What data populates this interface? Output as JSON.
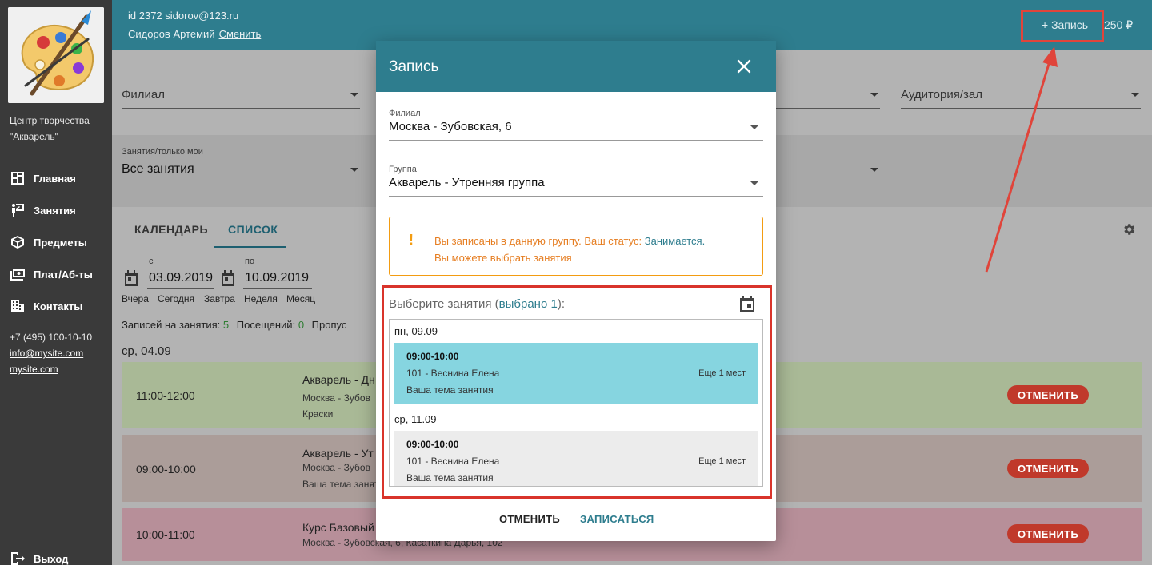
{
  "sidebar": {
    "org_name": "Центр творчества \"Акварель\"",
    "items": [
      {
        "label": "Главная",
        "icon": "dashboard-icon"
      },
      {
        "label": "Занятия",
        "icon": "lessons-icon"
      },
      {
        "label": "Предметы",
        "icon": "box-icon"
      },
      {
        "label": "Плат/Аб-ты",
        "icon": "money-icon"
      },
      {
        "label": "Контакты",
        "icon": "building-icon"
      }
    ],
    "phone": "+7 (495) 100-10-10",
    "email": "info@mysite.com",
    "site": "mysite.com",
    "logout": "Выход"
  },
  "header": {
    "user_id": "id 2372 sidorov@123.ru",
    "user_name": "Сидоров Артемий",
    "change_label": "Сменить",
    "record_label": "+ Запись",
    "balance": "250 ₽"
  },
  "filters": {
    "branch_label": "Филиал",
    "room_label": "Аудитория/зал",
    "lessons_label": "Занятия/только мои",
    "lessons_value": "Все занятия"
  },
  "tabs": {
    "calendar": "КАЛЕНДАРЬ",
    "list": "СПИСОК"
  },
  "dates": {
    "from_label": "с",
    "from_value": "03.09.2019",
    "to_label": "по",
    "to_value": "10.09.2019",
    "quick": [
      "Вчера",
      "Сегодня",
      "Завтра",
      "Неделя",
      "Месяц"
    ]
  },
  "stats": {
    "records_label": "Записей на занятия:",
    "records_value": "5",
    "visits_label": "Посещений:",
    "visits_value": "0",
    "missed_label": "Пропус"
  },
  "day_heading": "ср, 04.09",
  "lessons": [
    {
      "time": "11:00-12:00",
      "title": "Акварель - Дн",
      "line1": "Москва - Зубов",
      "line2": "Краски",
      "cancel": "ОТМЕНИТЬ"
    },
    {
      "time": "09:00-10:00",
      "title": "Акварель - Ут",
      "line1": "Москва - Зубов",
      "line2": "Ваша тема занят",
      "cancel": "ОТМЕНИТЬ"
    },
    {
      "time": "10:00-11:00",
      "title": "Курс Базовый",
      "line1": "Москва - Зубовская, 6, Касаткина Дарья, 102",
      "cancel": "ОТМЕНИТЬ"
    }
  ],
  "modal": {
    "title": "Запись",
    "branch_label": "Филиал",
    "branch_value": "Москва - Зубовская, 6",
    "group_label": "Группа",
    "group_value": "Акварель - Утренняя группа",
    "alert_line1": "Вы записаны в данную группу. Ваш статус:",
    "alert_status": "Занимается.",
    "alert_line2": "Вы можете выбрать занятия",
    "select_title": "Выберите занятия (",
    "select_count": "выбрано 1",
    "select_title_end": "):",
    "days": [
      {
        "day": "пн, 09.09",
        "time": "09:00-10:00",
        "room": "101 - Веснина Елена",
        "topic": "Ваша тема занятия",
        "seats": "Еще 1 мест"
      },
      {
        "day": "ср, 11.09",
        "time": "09:00-10:00",
        "room": "101 - Веснина Елена",
        "topic": "Ваша тема занятия",
        "seats": "Еще 1 мест"
      }
    ],
    "cancel_label": "ОТМЕНИТЬ",
    "submit_label": "ЗАПИСАТЬСЯ"
  },
  "colors": {
    "header": "#2e7d8e",
    "accent": "#2e7d8e",
    "danger": "#c0392b",
    "warning": "#f39c12",
    "highlight": "#e0443a"
  }
}
